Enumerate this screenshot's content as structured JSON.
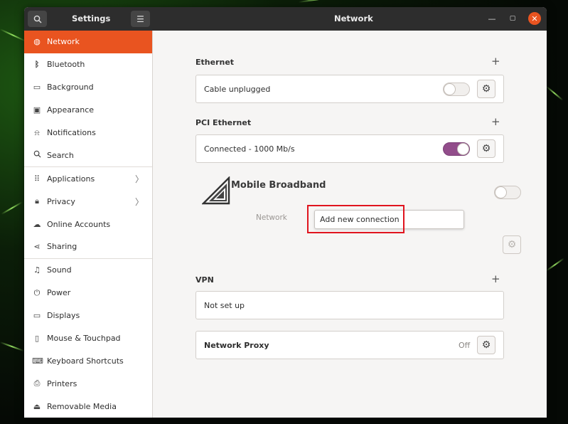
{
  "titlebar": {
    "app_title": "Settings",
    "page_title": "Network"
  },
  "sidebar": {
    "items": [
      {
        "label": "Network",
        "icon": "globe-icon",
        "active": true
      },
      {
        "label": "Bluetooth",
        "icon": "bluetooth-icon"
      },
      {
        "label": "Background",
        "icon": "monitor-icon"
      },
      {
        "label": "Appearance",
        "icon": "appearance-icon"
      },
      {
        "label": "Notifications",
        "icon": "bell-icon"
      },
      {
        "label": "Search",
        "icon": "search-icon"
      },
      {
        "label": "Applications",
        "icon": "grid-icon",
        "chevron": true
      },
      {
        "label": "Privacy",
        "icon": "lock-icon",
        "chevron": true
      },
      {
        "label": "Online Accounts",
        "icon": "cloud-icon"
      },
      {
        "label": "Sharing",
        "icon": "share-icon"
      },
      {
        "label": "Sound",
        "icon": "music-note-icon"
      },
      {
        "label": "Power",
        "icon": "power-icon"
      },
      {
        "label": "Displays",
        "icon": "display-icon"
      },
      {
        "label": "Mouse & Touchpad",
        "icon": "mouse-icon"
      },
      {
        "label": "Keyboard Shortcuts",
        "icon": "keyboard-icon"
      },
      {
        "label": "Printers",
        "icon": "printer-icon"
      },
      {
        "label": "Removable Media",
        "icon": "removable-media-icon"
      }
    ]
  },
  "ethernet": {
    "title": "Ethernet",
    "status": "Cable unplugged",
    "enabled": false
  },
  "pci_ethernet": {
    "title": "PCI Ethernet",
    "status": "Connected - 1000 Mb/s",
    "enabled": true
  },
  "mobile_broadband": {
    "title": "Mobile Broadband",
    "network_label": "Network",
    "popover_item": "Add new connection",
    "enabled": false
  },
  "vpn": {
    "title": "VPN",
    "status": "Not set up"
  },
  "proxy": {
    "title": "Network Proxy",
    "status": "Off"
  },
  "colors": {
    "accent": "#e95420",
    "toggle_on": "#924d8b",
    "highlight": "#e0141e"
  }
}
